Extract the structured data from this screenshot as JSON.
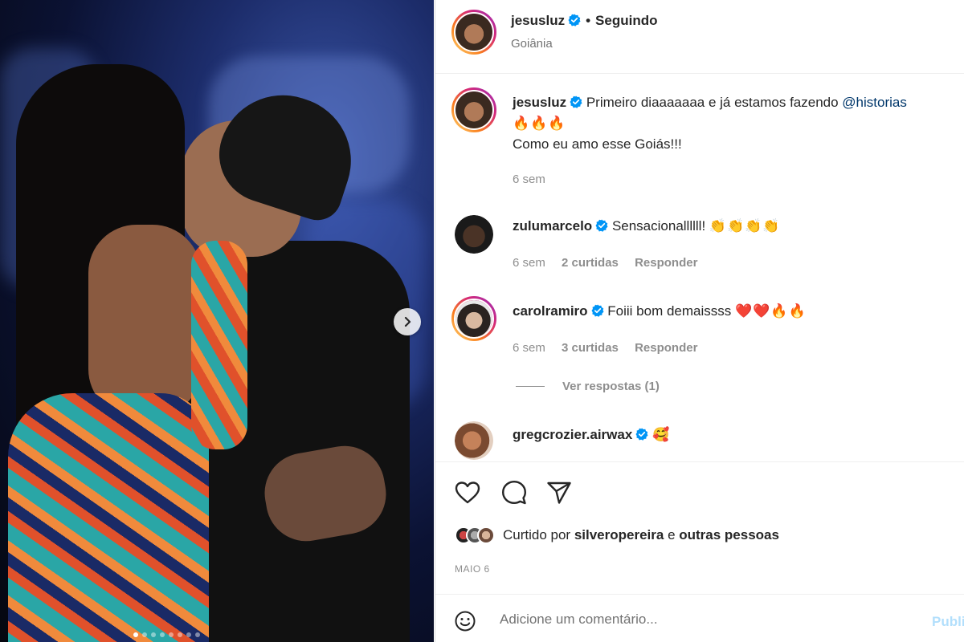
{
  "post": {
    "author": "jesusluz",
    "follow_status": "Seguindo",
    "separator": "•",
    "location": "Goiânia"
  },
  "caption": {
    "username": "jesusluz",
    "text_before": "Primeiro diaaaaaaa e já estamos fazendo ",
    "mention": "@historias",
    "emojis": "🔥🔥🔥",
    "line2": "Como eu amo esse Goiás!!!",
    "time": "6 sem"
  },
  "comments": [
    {
      "username": "zulumarcelo",
      "text": "Sensacionallllll! ",
      "emojis": "👏👏👏👏",
      "time": "6 sem",
      "likes": "2 curtidas",
      "reply": "Responder"
    },
    {
      "username": "carolramiro",
      "text": "Foiii bom demaissss ",
      "emojis": "❤️❤️🔥🔥",
      "time": "6 sem",
      "likes": "3 curtidas",
      "reply": "Responder",
      "view_replies": "Ver respostas (1)"
    },
    {
      "username": "gregcrozier.airwax",
      "text": "",
      "emojis": "🥰"
    }
  ],
  "liked_by": {
    "prefix": "Curtido por ",
    "user": "silveropereira",
    "middle": " e ",
    "others": "outras pessoas"
  },
  "date": "MAIO 6",
  "comment_box": {
    "placeholder": "Adicione um comentário...",
    "publish": "Publicar"
  },
  "carousel": {
    "total": 8,
    "active_index": 0
  },
  "icons": {
    "verified": "verified-badge-icon",
    "next": "chevron-right-icon",
    "like": "heart-icon",
    "comment": "comment-bubble-icon",
    "share": "paper-plane-icon",
    "emoji": "smiley-icon"
  },
  "colors": {
    "verified": "#0095f6",
    "mention": "#00376b",
    "muted": "#8e8e8e",
    "publish_disabled": "#b2dffc"
  }
}
